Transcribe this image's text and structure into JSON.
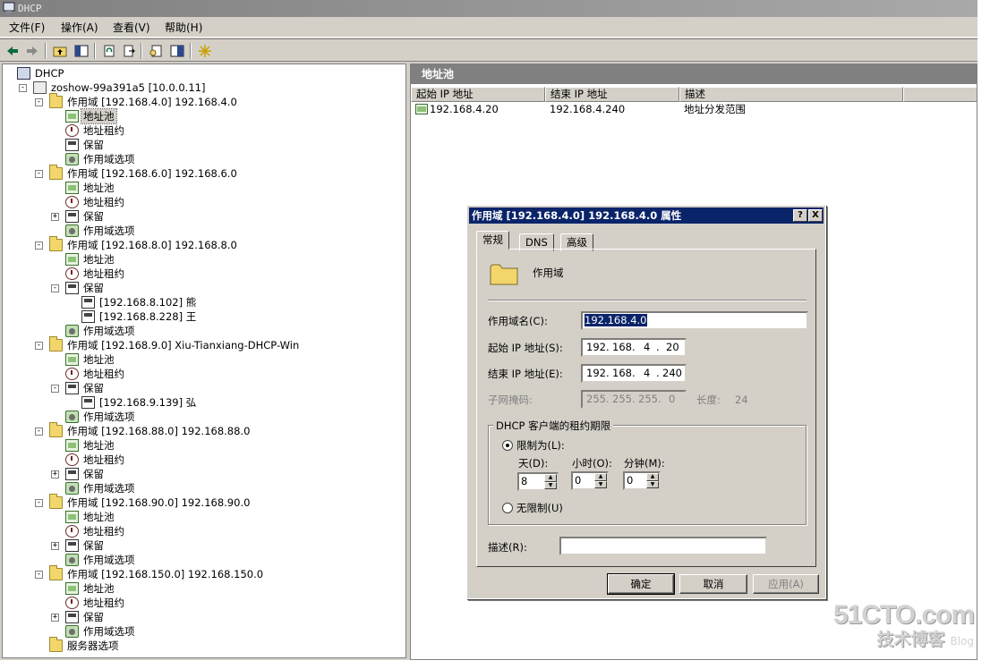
{
  "window": {
    "title": "DHCP"
  },
  "menu": [
    "文件(F)",
    "操作(A)",
    "查看(V)",
    "帮助(H)"
  ],
  "toolbar": [
    "back-icon",
    "forward-icon",
    "up-folder-icon",
    "show-tree-icon",
    "refresh-icon",
    "export-icon",
    "properties-icon",
    "help-icon",
    "star-icon"
  ],
  "tree": [
    {
      "label": "DHCP",
      "icon": "dhcp-icon",
      "depth": 0
    },
    {
      "label": "zoshow-99a391a5 [10.0.0.11]",
      "icon": "server-icon",
      "depth": 1,
      "exp": "-"
    },
    {
      "label": "作用域 [192.168.4.0] 192.168.4.0",
      "icon": "folder-icon",
      "depth": 2,
      "exp": "-"
    },
    {
      "label": "地址池",
      "icon": "pool-icon",
      "depth": 3,
      "selected": true
    },
    {
      "label": "地址租约",
      "icon": "lease-icon",
      "depth": 3
    },
    {
      "label": "保留",
      "icon": "reservation-icon",
      "depth": 3
    },
    {
      "label": "作用域选项",
      "icon": "options-icon",
      "depth": 3
    },
    {
      "label": "作用域 [192.168.6.0] 192.168.6.0",
      "icon": "folder-icon",
      "depth": 2,
      "exp": "-"
    },
    {
      "label": "地址池",
      "icon": "pool-icon",
      "depth": 3
    },
    {
      "label": "地址租约",
      "icon": "lease-icon",
      "depth": 3
    },
    {
      "label": "保留",
      "icon": "reservation-icon",
      "depth": 3,
      "exp": "+"
    },
    {
      "label": "作用域选项",
      "icon": "options-icon",
      "depth": 3
    },
    {
      "label": "作用域 [192.168.8.0] 192.168.8.0",
      "icon": "folder-icon",
      "depth": 2,
      "exp": "-"
    },
    {
      "label": "地址池",
      "icon": "pool-icon",
      "depth": 3
    },
    {
      "label": "地址租约",
      "icon": "lease-icon",
      "depth": 3
    },
    {
      "label": "保留",
      "icon": "reservation-icon",
      "depth": 3,
      "exp": "-"
    },
    {
      "label": "[192.168.8.102] 熊",
      "icon": "reservation-icon",
      "depth": 4
    },
    {
      "label": "[192.168.8.228] 王",
      "icon": "reservation-icon",
      "depth": 4
    },
    {
      "label": "作用域选项",
      "icon": "options-icon",
      "depth": 3
    },
    {
      "label": "作用域 [192.168.9.0] Xiu-Tianxiang-DHCP-Win",
      "icon": "folder-icon",
      "depth": 2,
      "exp": "-"
    },
    {
      "label": "地址池",
      "icon": "pool-icon",
      "depth": 3
    },
    {
      "label": "地址租约",
      "icon": "lease-icon",
      "depth": 3
    },
    {
      "label": "保留",
      "icon": "reservation-icon",
      "depth": 3,
      "exp": "-"
    },
    {
      "label": "[192.168.9.139] 弘",
      "icon": "reservation-icon",
      "depth": 4
    },
    {
      "label": "作用域选项",
      "icon": "options-icon",
      "depth": 3
    },
    {
      "label": "作用域 [192.168.88.0] 192.168.88.0",
      "icon": "folder-icon",
      "depth": 2,
      "exp": "-"
    },
    {
      "label": "地址池",
      "icon": "pool-icon",
      "depth": 3
    },
    {
      "label": "地址租约",
      "icon": "lease-icon",
      "depth": 3
    },
    {
      "label": "保留",
      "icon": "reservation-icon",
      "depth": 3,
      "exp": "+"
    },
    {
      "label": "作用域选项",
      "icon": "options-icon",
      "depth": 3
    },
    {
      "label": "作用域 [192.168.90.0] 192.168.90.0",
      "icon": "folder-icon",
      "depth": 2,
      "exp": "-"
    },
    {
      "label": "地址池",
      "icon": "pool-icon",
      "depth": 3
    },
    {
      "label": "地址租约",
      "icon": "lease-icon",
      "depth": 3
    },
    {
      "label": "保留",
      "icon": "reservation-icon",
      "depth": 3,
      "exp": "+"
    },
    {
      "label": "作用域选项",
      "icon": "options-icon",
      "depth": 3
    },
    {
      "label": "作用域 [192.168.150.0] 192.168.150.0",
      "icon": "folder-icon",
      "depth": 2,
      "exp": "-"
    },
    {
      "label": "地址池",
      "icon": "pool-icon",
      "depth": 3
    },
    {
      "label": "地址租约",
      "icon": "lease-icon",
      "depth": 3
    },
    {
      "label": "保留",
      "icon": "reservation-icon",
      "depth": 3,
      "exp": "+"
    },
    {
      "label": "作用域选项",
      "icon": "options-icon",
      "depth": 3
    },
    {
      "label": "服务器选项",
      "icon": "folder-icon",
      "depth": 2
    }
  ],
  "right_pane": {
    "header": "地址池",
    "columns": [
      "起始 IP 地址",
      "结束 IP 地址",
      "描述"
    ],
    "rows": [
      {
        "start": "192.168.4.20",
        "end": "192.168.4.240",
        "desc": "地址分发范围"
      }
    ]
  },
  "dialog": {
    "title": "作用域 [192.168.4.0] 192.168.4.0 属性",
    "help_btn": "?",
    "close_btn": "X",
    "tabs": [
      "常规",
      "DNS",
      "高级"
    ],
    "section_label": "作用域",
    "scope_name_label": "作用域名(C):",
    "scope_name_value": "192.168.4.0",
    "start_ip_label": "起始 IP 地址(S):",
    "start_ip": [
      "192",
      "168",
      "4",
      "20"
    ],
    "end_ip_label": "结束 IP 地址(E):",
    "end_ip": [
      "192",
      "168",
      "4",
      "240"
    ],
    "mask_label": "子网掩码:",
    "mask": [
      "255",
      "255",
      "255",
      "0"
    ],
    "length_label": "长度:",
    "length_value": "24",
    "lease_group_label": "DHCP 客户端的租约期限",
    "limited_label": "限制为(L):",
    "days_label": "天(D):",
    "days_value": "8",
    "hours_label": "小时(O):",
    "hours_value": "0",
    "minutes_label": "分钟(M):",
    "minutes_value": "0",
    "unlimited_label": "无限制(U)",
    "desc_label": "描述(R):",
    "desc_value": "",
    "ok": "确定",
    "cancel": "取消",
    "apply": "应用(A)"
  },
  "watermark": {
    "main": "51CTO.com",
    "sub": "技术博客",
    "blog": "Blog"
  }
}
